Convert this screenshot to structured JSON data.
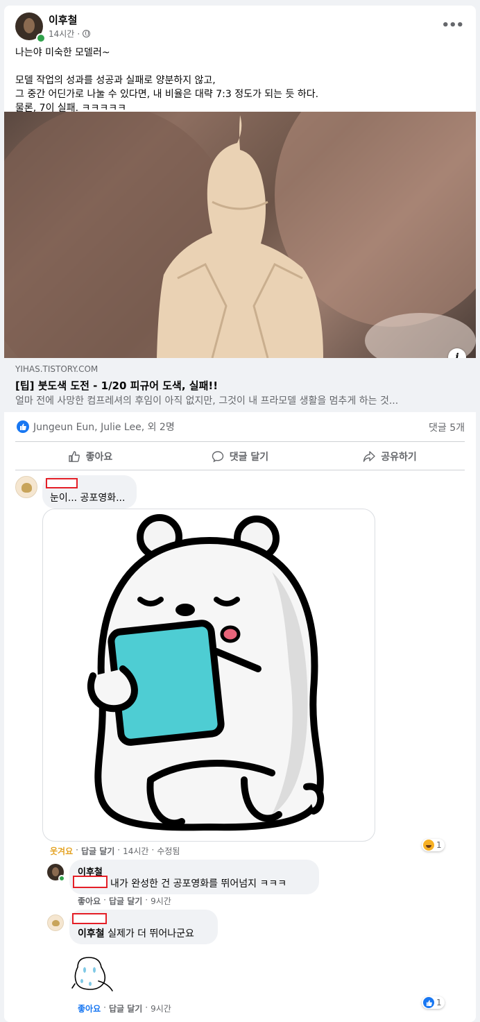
{
  "post": {
    "author": "이후철",
    "time": "14시간",
    "separator": "·",
    "text": "나는야 미숙한 모델러~\n\n모델 작업의 성과를 성공과 실패로 양분하지 않고,\n그 중간 어딘가로 나눌 수 있다면, 내 비율은 대략 7:3 정도가 되는 듯 하다.\n물론, 7이 실패. ㅋㅋㅋㅋㅋ",
    "more_label": "•••"
  },
  "link": {
    "domain": "YIHAS.TISTORY.COM",
    "title": "[팁] 붓도색 도전 - 1/20 피규어 도색, 실패!!",
    "description": "얼마 전에 사망한 컴프레셔의 후임이 아직 없지만, 그것이 내 프라모델 생활을 멈추게 하는 것...",
    "info_icon": "i"
  },
  "stats": {
    "reactors": "Jungeun Eun, Julie Lee, 외 2명",
    "comments": "댓글 5개"
  },
  "actions": {
    "like": "좋아요",
    "comment": "댓글 달기",
    "share": "공유하기"
  },
  "comments": [
    {
      "text": "눈이... 공포영화...",
      "reaction_label": "웃겨요",
      "reply": "답글 달기",
      "time": "14시간",
      "edited": "수정됨",
      "reaction_count": "1"
    },
    {
      "author": "이후철",
      "text": "내가 완성한 건 공포영화를 뛰어넘지 ㅋㅋㅋ",
      "like": "좋아요",
      "reply": "답글 달기",
      "time": "9시간"
    },
    {
      "mention": "이후철",
      "text": "실제가 더 뛰어나군요",
      "like": "좋아요",
      "reply": "답글 달기",
      "time": "9시간",
      "reaction_count": "1"
    }
  ],
  "colors": {
    "accent": "#1877f2",
    "online": "#31a24c",
    "haha": "#f7b125",
    "redaction": "#e41e26",
    "sticker_tablet": "#4ecdd3"
  }
}
